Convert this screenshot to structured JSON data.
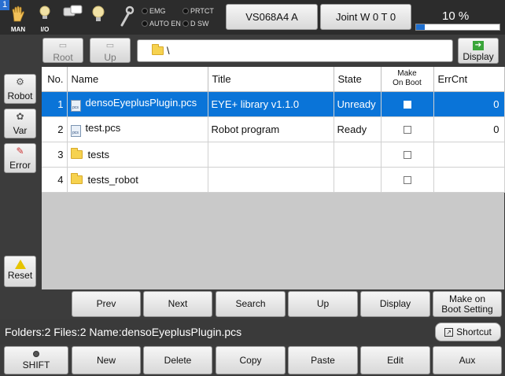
{
  "status": {
    "corner_number": "1",
    "mode_label": "MAN",
    "io_label": "I/O",
    "lamps": {
      "emg": "EMG",
      "auto_en": "AUTO EN",
      "prtct": "PRTCT",
      "dsw": "D SW"
    },
    "robot_button": "VS068A4 A",
    "joint_button": "Joint  W 0 T 0",
    "speed_text": "10 %",
    "speed_fraction": 0.1
  },
  "pathbar": {
    "root_label": "Root",
    "up_label": "Up",
    "path": "\\",
    "display_label": "Display"
  },
  "sidebar": {
    "robot_label": "Robot",
    "var_label": "Var",
    "error_label": "Error",
    "reset_label": "Reset"
  },
  "table": {
    "headers": {
      "no": "No.",
      "name": "Name",
      "title": "Title",
      "state": "State",
      "make_on_boot_1": "Make",
      "make_on_boot_2": "On Boot",
      "errcnt": "ErrCnt"
    },
    "rows": [
      {
        "no": "1",
        "icon": "pcs-file-icon",
        "name": "densoEyeplusPlugin.pcs",
        "title": "EYE+ library v1.1.0",
        "state": "Unready",
        "make_on_boot": false,
        "errcnt": "0",
        "selected": true
      },
      {
        "no": "2",
        "icon": "pcs-file-icon",
        "name": "test.pcs",
        "title": "Robot program",
        "state": "Ready",
        "make_on_boot": false,
        "errcnt": "0",
        "selected": false
      },
      {
        "no": "3",
        "icon": "folder-icon",
        "name": "tests",
        "title": "",
        "state": "",
        "make_on_boot": false,
        "errcnt": "",
        "selected": false
      },
      {
        "no": "4",
        "icon": "folder-icon",
        "name": "tests_robot",
        "title": "",
        "state": "",
        "make_on_boot": false,
        "errcnt": "",
        "selected": false
      }
    ]
  },
  "actions": {
    "prev": "Prev",
    "next": "Next",
    "search": "Search",
    "up": "Up",
    "display": "Display",
    "make_on_boot_1": "Make on",
    "make_on_boot_2": "Boot Setting"
  },
  "info": {
    "text": "Folders:2  Files:2  Name:densoEyeplusPlugin.pcs",
    "shortcut_label": "Shortcut"
  },
  "bottom": {
    "shift": "SHIFT",
    "new": "New",
    "delete": "Delete",
    "copy": "Copy",
    "paste": "Paste",
    "edit": "Edit",
    "aux": "Aux"
  }
}
